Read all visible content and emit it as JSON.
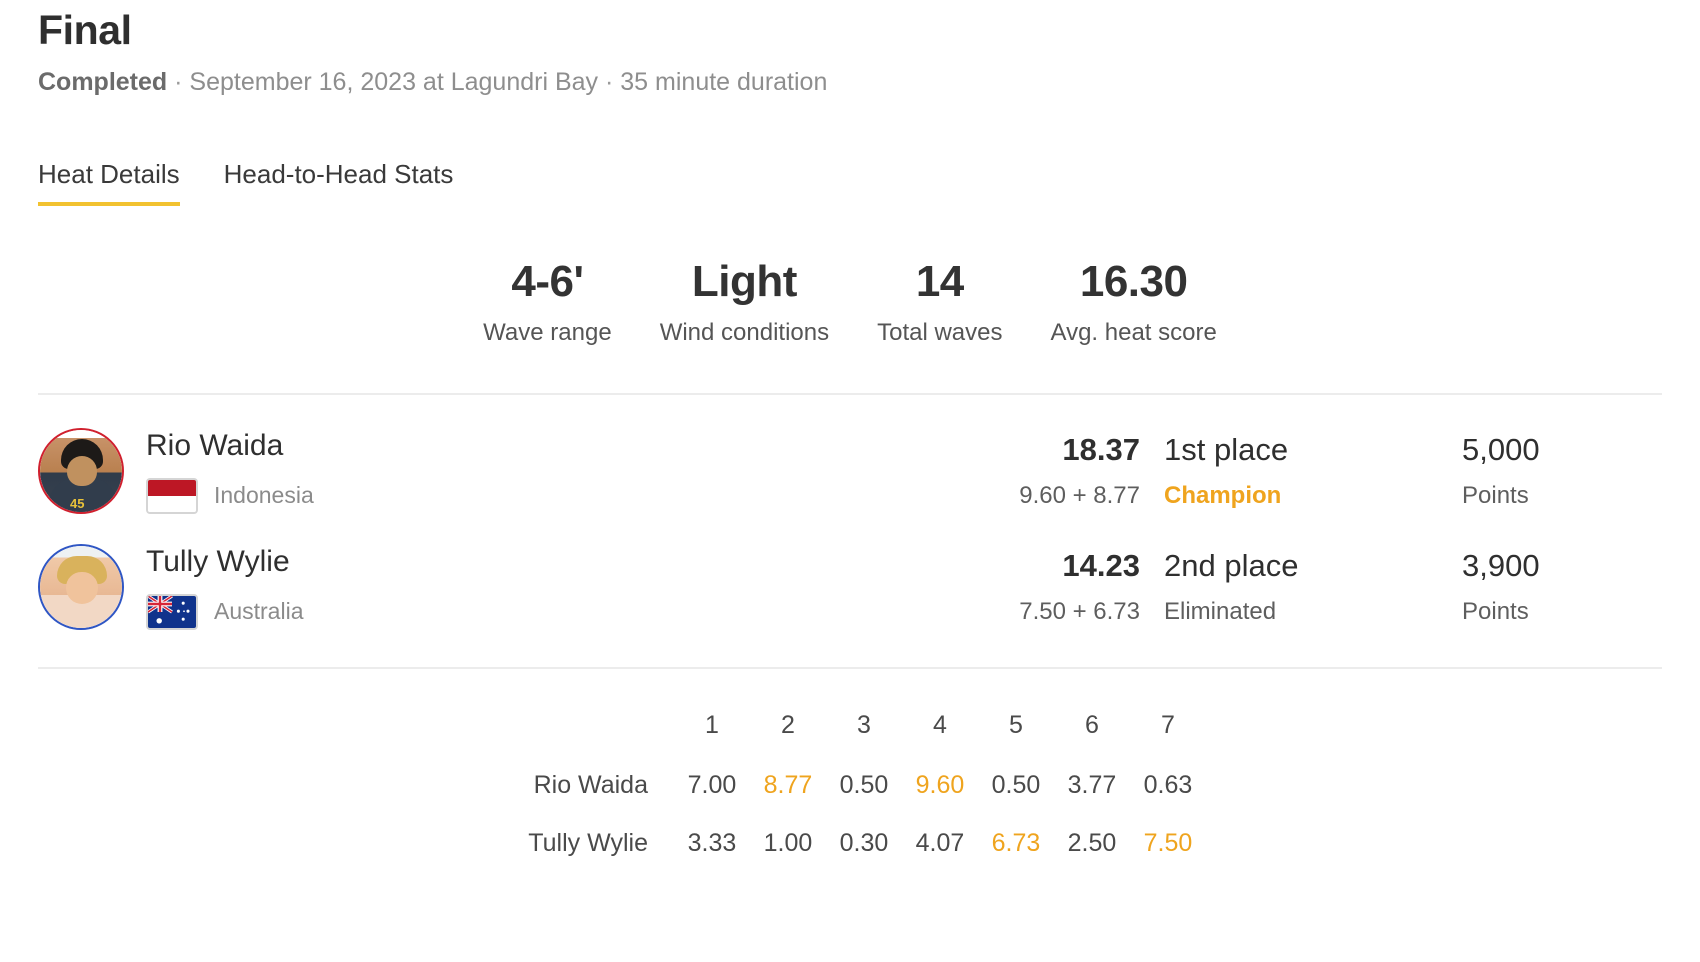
{
  "header": {
    "title": "Final",
    "status": "Completed",
    "separator": "·",
    "datetime": "September 16, 2023 at Lagundri Bay",
    "duration": "35 minute duration"
  },
  "tabs": [
    {
      "label": "Heat Details",
      "active": true
    },
    {
      "label": "Head-to-Head Stats",
      "active": false
    }
  ],
  "stats": [
    {
      "value": "4-6'",
      "label": "Wave range"
    },
    {
      "value": "Light",
      "label": "Wind conditions"
    },
    {
      "value": "14",
      "label": "Total waves"
    },
    {
      "value": "16.30",
      "label": "Avg. heat score"
    }
  ],
  "athletes": [
    {
      "name": "Rio Waida",
      "country": "Indonesia",
      "flag": "indonesia-flag",
      "ring_color": "#d0202e",
      "total": "18.37",
      "two_best": "9.60 + 8.77",
      "place": "1st place",
      "result": "Champion",
      "result_is_gold": true,
      "points": "5,000",
      "points_label": "Points"
    },
    {
      "name": "Tully Wylie",
      "country": "Australia",
      "flag": "australia-flag",
      "ring_color": "#2f56c4",
      "total": "14.23",
      "two_best": "7.50 + 6.73",
      "place": "2nd place",
      "result": "Eliminated",
      "result_is_gold": false,
      "points": "3,900",
      "points_label": "Points"
    }
  ],
  "wave_table": {
    "columns": [
      "1",
      "2",
      "3",
      "4",
      "5",
      "6",
      "7"
    ],
    "rows": [
      {
        "name": "Rio Waida",
        "scores": [
          "7.00",
          "8.77",
          "0.50",
          "9.60",
          "0.50",
          "3.77",
          "0.63"
        ],
        "best_indexes": [
          1,
          3
        ]
      },
      {
        "name": "Tully Wylie",
        "scores": [
          "3.33",
          "1.00",
          "0.30",
          "4.07",
          "6.73",
          "2.50",
          "7.50"
        ],
        "best_indexes": [
          4,
          6
        ]
      }
    ]
  },
  "colors": {
    "accent_gold": "#efa41e",
    "tab_underline": "#f2c230",
    "text_primary": "#2f2f2f",
    "text_muted": "#8b8b8b",
    "divider": "#ececec"
  }
}
